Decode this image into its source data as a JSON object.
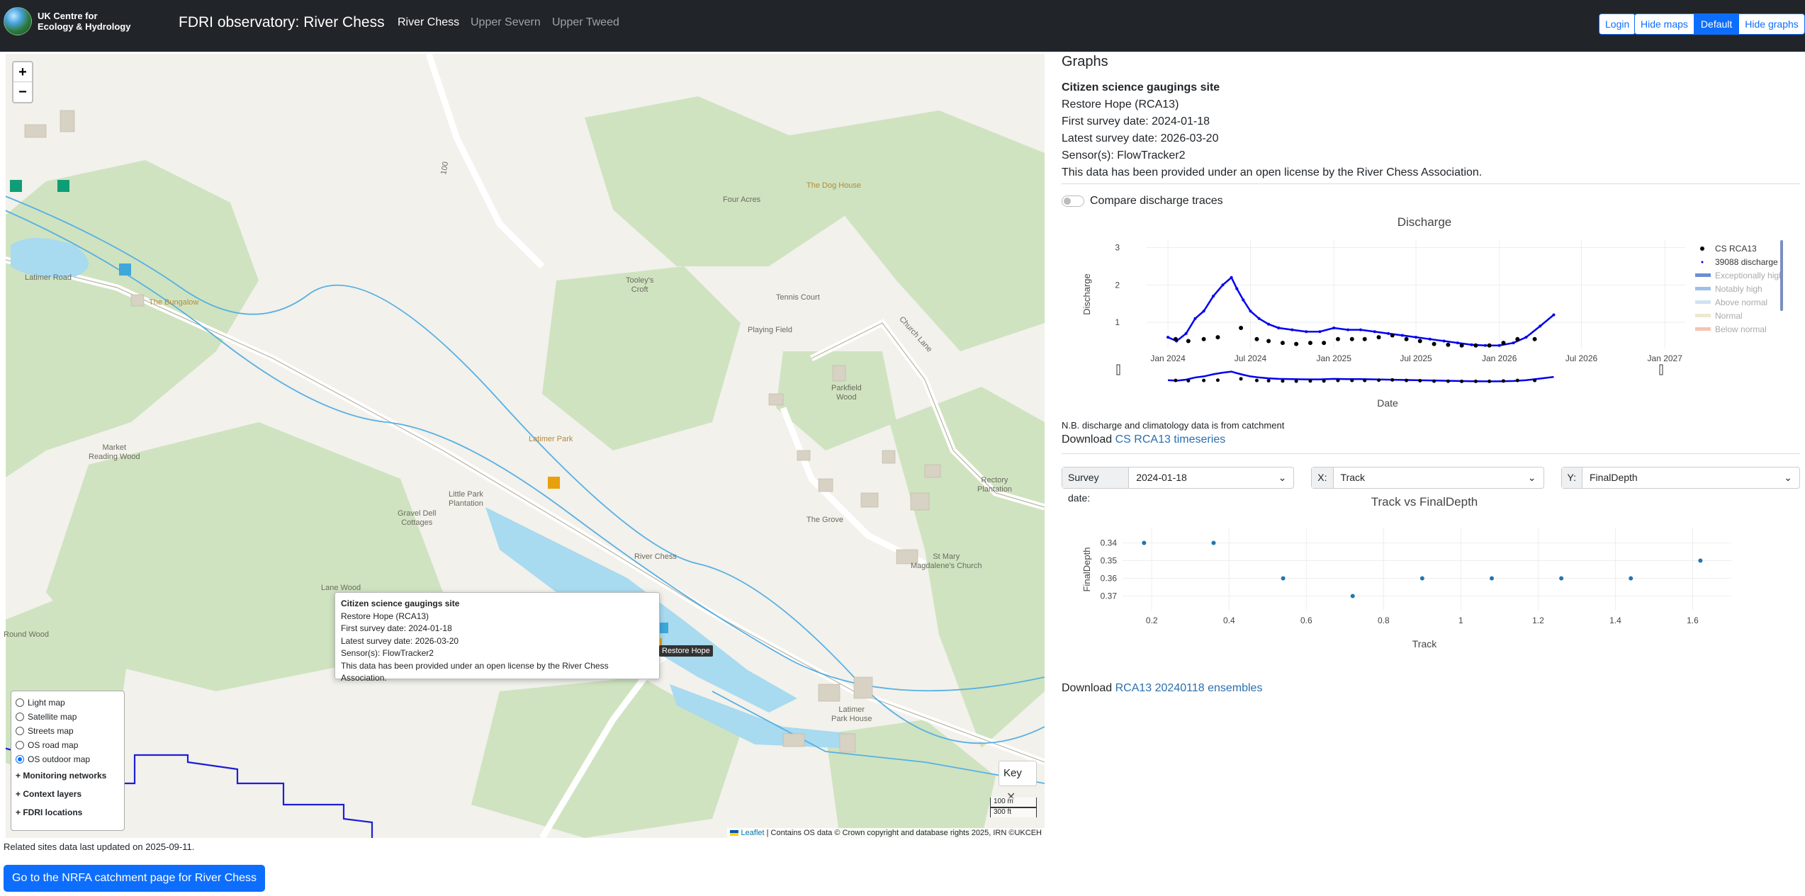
{
  "header": {
    "org_line1": "UK Centre for",
    "org_line2": "Ecology & Hydrology",
    "title": "FDRI observatory: River Chess",
    "nav": [
      "River Chess",
      "Upper Severn",
      "Upper Tweed"
    ],
    "login": "Login",
    "view_buttons": [
      "Hide maps",
      "Default",
      "Hide graphs"
    ]
  },
  "map": {
    "zoom_in": "+",
    "zoom_out": "−",
    "places": {
      "latimer_road": "Latimer Road",
      "bungalow": "The Bungalow",
      "contour": "100",
      "four_acres": "Four Acres",
      "dog_house": "The Dog House",
      "tooleys_croft": "Tooley's\nCroft",
      "tennis_court": "Tennis Court",
      "playing_field": "Playing Field",
      "church_lane": "Church Lane",
      "parkfield_wood": "Parkfield\nWood",
      "market_reading_wood": "Market\nReading Wood",
      "latimer_park": "Latimer Park",
      "little_park_plantation": "Little Park\nPlantation",
      "gravel_dell": "Gravel Dell\nCottages",
      "the_grove": "The Grove",
      "rectory_plantation": "Rectory\nPlantation",
      "river_chess": "River Chess",
      "st_mary": "St Mary\nMagdalene's Church",
      "lane_wood": "Lane Wood",
      "round_wood": "Round Wood",
      "latimer_park_house": "Latimer\nPark House"
    },
    "popup": {
      "heading": "Citizen science gaugings site",
      "site": "Restore Hope (RCA13)",
      "first": "First survey date: 2024-01-18",
      "latest": "Latest survey date: 2026-03-20",
      "sensor": "Sensor(s): FlowTracker2",
      "license": "This data has been provided under an open license by the River Chess Association."
    },
    "tooltip": "Restore Hope",
    "base_layers": [
      "Light map",
      "Satellite map",
      "Streets map",
      "OS road map",
      "OS outdoor map"
    ],
    "selected_layer": "OS outdoor map",
    "sections": [
      "+ Monitoring networks",
      "+ Context layers",
      "+ FDRI locations"
    ],
    "key": "Key",
    "scale_m": "100 m",
    "scale_ft": "300 ft",
    "attribution_link": "Leaflet",
    "attribution_text": " | Contains OS data © Crown copyright and database rights 2025, IRN ©UKCEH"
  },
  "footer": {
    "updated": "Related sites data last updated on 2025-09-11.",
    "nrfa_button": "Go to the NRFA catchment page for River Chess"
  },
  "panel": {
    "title": "Graphs",
    "heading": "Citizen science gaugings site",
    "site": "Restore Hope (RCA13)",
    "first": "First survey date: 2024-01-18",
    "latest": "Latest survey date: 2026-03-20",
    "sensor": "Sensor(s): FlowTracker2",
    "license": "This data has been provided under an open license by the River Chess Association.",
    "compare": "Compare discharge traces",
    "note": "N.B. discharge and climatology data is from catchment",
    "download1_prefix": "Download ",
    "download1_link": "CS RCA13 timeseries",
    "survey_label": "Survey date:",
    "survey_value": "2024-01-18",
    "x_label": "X:",
    "x_value": "Track",
    "y_label": "Y:",
    "y_value": "FinalDepth",
    "download2_prefix": "Download ",
    "download2_link": "RCA13 20240118 ensembles"
  },
  "chart_data": [
    {
      "type": "line",
      "title": "Discharge",
      "xlabel": "Date",
      "ylabel": "Discharge",
      "x_ticks": [
        "Jan 2024",
        "Jul 2024",
        "Jan 2025",
        "Jul 2025",
        "Jan 2026",
        "Jul 2026",
        "Jan 2027"
      ],
      "y_ticks": [
        1,
        2,
        3
      ],
      "ylim": [
        0.3,
        3.2
      ],
      "legend": [
        "CS RCA13",
        "39088 discharge",
        "Exceptionally high",
        "Notably high",
        "Above normal",
        "Normal",
        "Below normal"
      ],
      "legend_placement": "right",
      "series": [
        {
          "name": "CS RCA13",
          "color": "#000000",
          "x": [
            "2024-01-18",
            "2024-02-15",
            "2024-03-20",
            "2024-04-20",
            "2024-06-10",
            "2024-07-15",
            "2024-08-10",
            "2024-09-10",
            "2024-10-10",
            "2024-11-10",
            "2024-12-10",
            "2025-01-10",
            "2025-02-10",
            "2025-03-10",
            "2025-04-10",
            "2025-05-10",
            "2025-06-10",
            "2025-07-10",
            "2025-08-10",
            "2025-09-10",
            "2025-10-10",
            "2025-11-10",
            "2025-12-10",
            "2026-01-10",
            "2026-02-10",
            "2026-03-20"
          ],
          "y": [
            0.55,
            0.5,
            0.55,
            0.6,
            0.85,
            0.55,
            0.5,
            0.45,
            0.42,
            0.45,
            0.45,
            0.55,
            0.55,
            0.55,
            0.6,
            0.65,
            0.55,
            0.5,
            0.42,
            0.4,
            0.38,
            0.38,
            0.38,
            0.45,
            0.55,
            0.55
          ]
        },
        {
          "name": "39088 discharge",
          "color": "#0000ee",
          "x": [
            "2024-01-01",
            "2024-01-20",
            "2024-02-10",
            "2024-03-01",
            "2024-03-20",
            "2024-04-10",
            "2024-05-01",
            "2024-05-20",
            "2024-06-01",
            "2024-06-15",
            "2024-07-01",
            "2024-07-20",
            "2024-08-10",
            "2024-09-01",
            "2024-10-01",
            "2024-11-01",
            "2024-12-01",
            "2025-01-01",
            "2025-02-01",
            "2025-03-01",
            "2025-04-01",
            "2025-05-01",
            "2025-06-01",
            "2025-07-01",
            "2025-08-01",
            "2025-09-01",
            "2025-10-01",
            "2025-11-01",
            "2025-12-01",
            "2026-01-01",
            "2026-02-01",
            "2026-03-01",
            "2026-04-01",
            "2026-05-01"
          ],
          "y": [
            0.6,
            0.5,
            0.7,
            1.1,
            1.3,
            1.7,
            2.0,
            2.2,
            1.9,
            1.6,
            1.3,
            1.1,
            0.95,
            0.85,
            0.8,
            0.75,
            0.75,
            0.85,
            0.8,
            0.8,
            0.75,
            0.7,
            0.65,
            0.6,
            0.55,
            0.5,
            0.45,
            0.4,
            0.38,
            0.38,
            0.45,
            0.6,
            0.9,
            1.2
          ]
        }
      ]
    },
    {
      "type": "scatter",
      "title": "Track vs FinalDepth",
      "xlabel": "Track",
      "ylabel": "FinalDepth",
      "x_ticks": [
        0.2,
        0.4,
        0.6,
        0.8,
        1,
        1.2,
        1.4,
        1.6
      ],
      "y_ticks": [
        0.34,
        0.35,
        0.36,
        0.37
      ],
      "y_reversed": true,
      "x": [
        0.18,
        0.36,
        0.54,
        0.72,
        0.9,
        1.08,
        1.26,
        1.44,
        1.62
      ],
      "y": [
        0.34,
        0.34,
        0.36,
        0.37,
        0.36,
        0.36,
        0.36,
        0.36,
        0.35
      ],
      "color": "#1f77b4"
    }
  ]
}
